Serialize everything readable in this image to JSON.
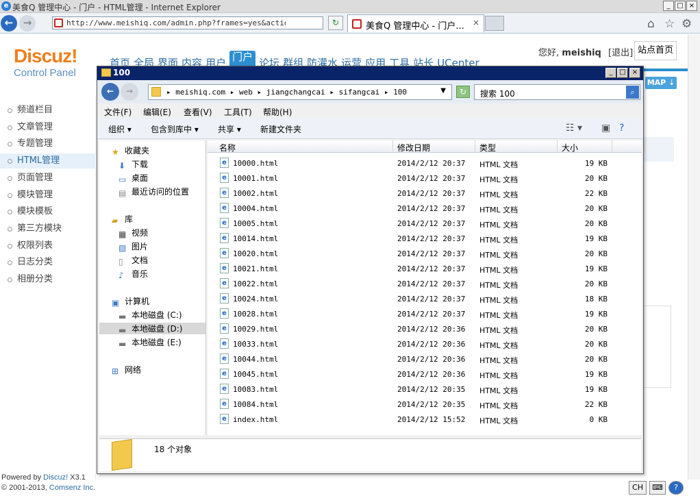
{
  "ie": {
    "title": "美食Q 管理中心 - 门户 - HTML管理 - Internet Explorer",
    "address": "http://www.meishiq.com/admin.php?frames=yes&action=articl",
    "tab_title": "美食Q 管理中心 - 门户...",
    "back_label": "←",
    "fwd_label": "→",
    "refresh_label": "↻",
    "tab_close": "×",
    "home_icon": "⌂",
    "star_icon": "☆",
    "gear_icon": "⚙",
    "min": "_",
    "max": "□",
    "close": "×"
  },
  "dz": {
    "logo": "Discuz!",
    "logo_sub": "Control Panel",
    "nav": [
      "首页",
      "全局",
      "界面",
      "内容",
      "用户",
      "门户",
      "论坛",
      "群组",
      "防灌水",
      "运营",
      "应用",
      "工具",
      "站长",
      "UCenter"
    ],
    "nav_active": 5,
    "greeting": "您好,",
    "username": "meishiq",
    "logout": "[退出]",
    "site_home": "站点首页",
    "map": "MAP ⇣",
    "side": [
      "频道栏目",
      "文章管理",
      "专题管理",
      "HTML管理",
      "页面管理",
      "模块管理",
      "模块模板",
      "第三方模块",
      "权限列表",
      "日志分类",
      "相册分类"
    ],
    "side_active": 3,
    "footer_powered": "Powered by",
    "footer_brand": "Discuz!",
    "footer_ver": "X3.1",
    "footer_copy": "© 2001-2013,",
    "footer_company": "Comsenz Inc."
  },
  "explorer": {
    "title": "100",
    "path": "▸ meishiq.com ▸ web ▸ jiangchangcai ▸ sifangcai ▸ 100",
    "search": "搜索 100",
    "menu": [
      "文件(F)",
      "编辑(E)",
      "查看(V)",
      "工具(T)",
      "帮助(H)"
    ],
    "toolbar": [
      "组织 ▾",
      "包含到库中 ▾",
      "共享 ▾",
      "新建文件夹"
    ],
    "nav_items": [
      {
        "label": "收藏夹",
        "icon": "star-icon",
        "glyph": "★"
      },
      {
        "label": "下载",
        "icon": "download-folder-icon",
        "glyph": "⬇"
      },
      {
        "label": "桌面",
        "icon": "desktop-icon",
        "glyph": "▭"
      },
      {
        "label": "最近访问的位置",
        "icon": "recent-places-icon",
        "glyph": "▤"
      },
      {
        "label": "库",
        "icon": "library-icon",
        "glyph": "▰"
      },
      {
        "label": "视频",
        "icon": "video-icon",
        "glyph": "▦"
      },
      {
        "label": "图片",
        "icon": "picture-icon",
        "glyph": "▧"
      },
      {
        "label": "文档",
        "icon": "document-icon",
        "glyph": "▯"
      },
      {
        "label": "音乐",
        "icon": "music-icon",
        "glyph": "♪"
      },
      {
        "label": "计算机",
        "icon": "computer-icon",
        "glyph": "▣"
      },
      {
        "label": "本地磁盘 (C:)",
        "icon": "disk-c-icon",
        "glyph": "▬"
      },
      {
        "label": "本地磁盘 (D:)",
        "icon": "disk-d-icon",
        "glyph": "▬"
      },
      {
        "label": "本地磁盘 (E:)",
        "icon": "disk-e-icon",
        "glyph": "▬"
      },
      {
        "label": "网络",
        "icon": "network-icon",
        "glyph": "⊞"
      }
    ],
    "columns": [
      "名称",
      "修改日期",
      "类型",
      "大小"
    ],
    "files": [
      {
        "name": "10000.html",
        "date": "2014/2/12 20:37",
        "type": "HTML 文档",
        "size": "19 KB"
      },
      {
        "name": "10001.html",
        "date": "2014/2/12 20:37",
        "type": "HTML 文档",
        "size": "20 KB"
      },
      {
        "name": "10002.html",
        "date": "2014/2/12 20:37",
        "type": "HTML 文档",
        "size": "22 KB"
      },
      {
        "name": "10004.html",
        "date": "2014/2/12 20:37",
        "type": "HTML 文档",
        "size": "20 KB"
      },
      {
        "name": "10005.html",
        "date": "2014/2/12 20:37",
        "type": "HTML 文档",
        "size": "20 KB"
      },
      {
        "name": "10014.html",
        "date": "2014/2/12 20:37",
        "type": "HTML 文档",
        "size": "19 KB"
      },
      {
        "name": "10020.html",
        "date": "2014/2/12 20:37",
        "type": "HTML 文档",
        "size": "20 KB"
      },
      {
        "name": "10021.html",
        "date": "2014/2/12 20:37",
        "type": "HTML 文档",
        "size": "19 KB"
      },
      {
        "name": "10022.html",
        "date": "2014/2/12 20:37",
        "type": "HTML 文档",
        "size": "20 KB"
      },
      {
        "name": "10024.html",
        "date": "2014/2/12 20:37",
        "type": "HTML 文档",
        "size": "18 KB"
      },
      {
        "name": "10028.html",
        "date": "2014/2/12 20:37",
        "type": "HTML 文档",
        "size": "19 KB"
      },
      {
        "name": "10029.html",
        "date": "2014/2/12 20:36",
        "type": "HTML 文档",
        "size": "20 KB"
      },
      {
        "name": "10033.html",
        "date": "2014/2/12 20:36",
        "type": "HTML 文档",
        "size": "20 KB"
      },
      {
        "name": "10044.html",
        "date": "2014/2/12 20:36",
        "type": "HTML 文档",
        "size": "20 KB"
      },
      {
        "name": "10045.html",
        "date": "2014/2/12 20:36",
        "type": "HTML 文档",
        "size": "19 KB"
      },
      {
        "name": "10083.html",
        "date": "2014/2/12 20:35",
        "type": "HTML 文档",
        "size": "19 KB"
      },
      {
        "name": "10084.html",
        "date": "2014/2/12 20:35",
        "type": "HTML 文档",
        "size": "22 KB"
      },
      {
        "name": "index.html",
        "date": "2014/2/12 15:52",
        "type": "HTML 文档",
        "size": "0 KB"
      }
    ],
    "status_count": "18 个对象"
  },
  "taskbar": {
    "ime": "CH",
    "help": "?"
  }
}
